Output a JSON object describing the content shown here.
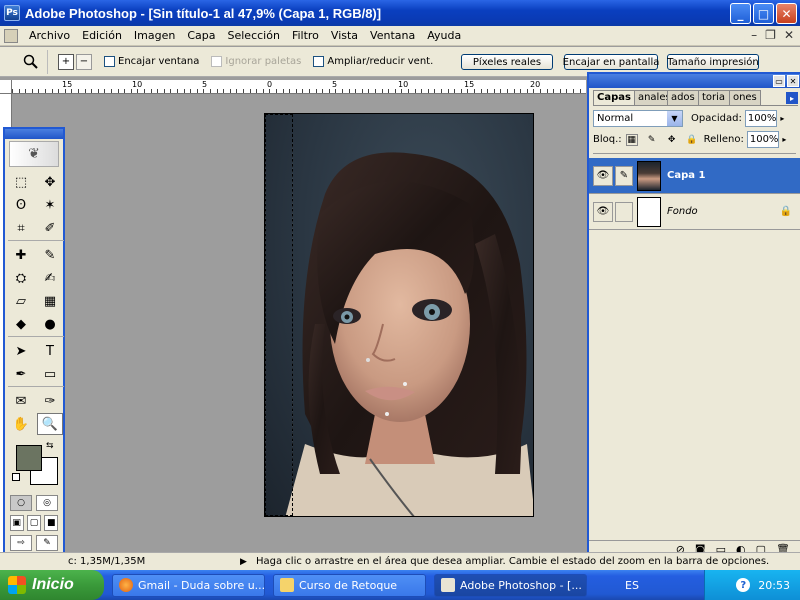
{
  "window": {
    "title": "Adobe Photoshop - [Sin título-1 al 47,9% (Capa 1, RGB/8)]",
    "app_icon": "Ps",
    "buttons": {
      "minimize": "_",
      "maximize": "□",
      "close": "✕"
    }
  },
  "menu": {
    "items": [
      "Archivo",
      "Edición",
      "Imagen",
      "Capa",
      "Selección",
      "Filtro",
      "Vista",
      "Ventana",
      "Ayuda"
    ],
    "mdi": {
      "minimize": "–",
      "restore": "❐",
      "close": "✕"
    }
  },
  "options": {
    "tool_icon": "zoom-icon",
    "zoom_in": "+",
    "zoom_out": "−",
    "fit_window_label": "Encajar ventana",
    "ignore_palettes_label": "Ignorar paletas",
    "resize_windows_label": "Ampliar/reducir vent.",
    "actual_pixels_label": "Píxeles reales",
    "fit_screen_label": "Encajar en pantalla",
    "print_size_label": "Tamaño impresión"
  },
  "ruler": {
    "top_labels": [
      "15",
      "10",
      "5",
      "0",
      "5",
      "10",
      "15",
      "20"
    ]
  },
  "toolbox": {
    "tools": [
      "⬚",
      "✥",
      "ʘ",
      "✶",
      "⌗",
      "✐",
      "✚",
      "✎",
      "⛭",
      "✍",
      "▱",
      "▦",
      "◆",
      "●",
      "➤",
      "T",
      "✒",
      "▭",
      "✉",
      "✑",
      "✋",
      "🔍"
    ],
    "swap": "⇆",
    "mode": [
      "○",
      "◎"
    ],
    "screen": [
      "▣",
      "▢",
      "■"
    ],
    "jump": [
      "⇨",
      "✎"
    ]
  },
  "colors": {
    "foreground": "#6b7461",
    "background": "#ffffff",
    "selection_highlight": "#316ac5"
  },
  "layers": {
    "tabs": [
      "Capas",
      "anales",
      "ados",
      "toria",
      "ones"
    ],
    "active_tab": "Capas",
    "blend_mode": "Normal",
    "opacity_label": "Opacidad:",
    "opacity_value": "100%",
    "lock_label": "Bloq.:",
    "fill_label": "Relleno:",
    "fill_value": "100%",
    "items": [
      {
        "name": "Capa 1",
        "selected": true,
        "locked": false
      },
      {
        "name": "Fondo",
        "selected": false,
        "locked": true
      }
    ],
    "footer_icons": [
      "⊘",
      "◙",
      "▭",
      "◐",
      "▢",
      "🗑"
    ]
  },
  "status": {
    "doc": "c: 1,35M/1,35M",
    "hint": "Haga clic o arrastre en el área que desea ampliar. Cambie el estado del zoom en la barra de opciones."
  },
  "taskbar": {
    "start_label": "Inicio",
    "tasks": [
      {
        "label": "Gmail - Duda sobre u...",
        "active": false
      },
      {
        "label": "Curso de Retoque",
        "active": false
      },
      {
        "label": "Adobe Photoshop - [...",
        "active": true
      }
    ],
    "lang": "ES",
    "help": "?",
    "time": "20:53"
  }
}
